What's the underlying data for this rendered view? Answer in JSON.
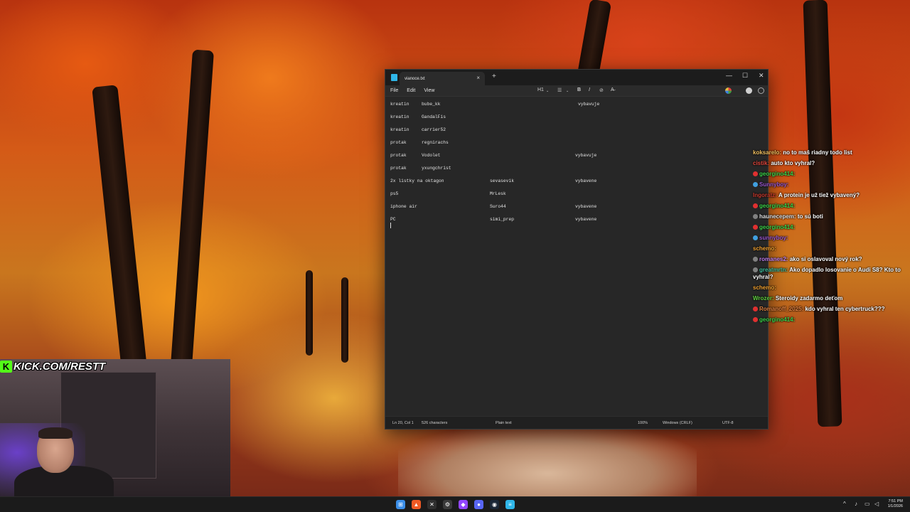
{
  "notepad": {
    "tab_title": "vianoce.txt",
    "tab_close": "×",
    "new_tab": "+",
    "window_controls": {
      "minimize": "—",
      "maximize": "☐",
      "close": "✕"
    },
    "menu": [
      "File",
      "Edit",
      "View"
    ],
    "format_toolbar": {
      "heading": "H1",
      "list": "☰",
      "bold": "B",
      "italic": "I",
      "link": "⊘",
      "clear": "A̶"
    },
    "lines": [
      {
        "c1": "kreatin",
        "c2": "bube_kk",
        "c3": "",
        "c4": "vybavuje"
      },
      {
        "c1": "kreatin",
        "c2": "GandalFis",
        "c3": "",
        "c4": ""
      },
      {
        "c1": "kreatin",
        "c2": "carrier52",
        "c3": "",
        "c4": ""
      },
      {
        "c1": "protak",
        "c2": "regnirachs",
        "c3": "",
        "c4": ""
      },
      {
        "c1": "protak",
        "c2": "Vodolet",
        "c3": "",
        "c4": "vybavuje"
      },
      {
        "c1": "protak",
        "c2": "yxungchrist",
        "c3": "",
        "c4": ""
      },
      {
        "c1": "2x listky na oktagon",
        "c2": "",
        "c3": "sevasevik",
        "c4": "vybavene"
      },
      {
        "c1": "ps5",
        "c2": "",
        "c3": "MrLesk",
        "c4": ""
      },
      {
        "c1": "iphone air",
        "c2": "",
        "c3": "Suro44",
        "c4": "vybavene"
      },
      {
        "c1": "PC",
        "c2": "",
        "c3": "simi_prep",
        "c4": "vybavene"
      }
    ],
    "status": {
      "position": "Ln 20, Col 1",
      "characters": "526 characters",
      "format": "Plain text",
      "zoom": "100%",
      "line_ending": "Windows (CRLF)",
      "encoding": "UTF-8"
    }
  },
  "chat": [
    {
      "user": "koksarelo:",
      "text": "no to maš riadny todo list",
      "color": "#f0c060",
      "badge": ""
    },
    {
      "user": "cistik:",
      "text": "auto kto vyhral?",
      "color": "#e0463c",
      "badge": ""
    },
    {
      "user": "georgino414:",
      "text": "",
      "color": "#3bd24a",
      "badge": "#e03030"
    },
    {
      "user": "Sunnyboy:",
      "text": "",
      "color": "#9b59d0",
      "badge": "#40a0e0"
    },
    {
      "user": "Ingoratz:",
      "text": "A protein je už tiež vybavený?",
      "color": "#c83a2e",
      "badge": ""
    },
    {
      "user": "georgino414:",
      "text": "",
      "color": "#3bd24a",
      "badge": "#e03030"
    },
    {
      "user": "haunecepem:",
      "text": "to sú boti",
      "color": "#e0e0e0",
      "badge": "#808080"
    },
    {
      "user": "georgino414:",
      "text": "",
      "color": "#3bd24a",
      "badge": "#e03030"
    },
    {
      "user": "sunnyboy:",
      "text": "",
      "color": "#9b59d0",
      "badge": "#40a0e0"
    },
    {
      "user": "schemo:",
      "text": "",
      "color": "#f0a030",
      "badge": ""
    },
    {
      "user": "romanes2:",
      "text": "ako si oslavoval nový rok?",
      "color": "#c080f0",
      "badge": "#808080"
    },
    {
      "user": "greatmrtn:",
      "text": "Ako dopadlo losovanie o Audi S8? Kto to vyhral?",
      "color": "#40c0a0",
      "badge": "#808080"
    },
    {
      "user": "schemo:",
      "text": "",
      "color": "#f0a030",
      "badge": ""
    },
    {
      "user": "Wrozer:",
      "text": "Steroidy zadarmo deťom",
      "color": "#60d040",
      "badge": ""
    },
    {
      "user": "Romanoff_2025:",
      "text": "kdo vyhral ten cybertruck???",
      "color": "#e08040",
      "badge": "#e03030"
    },
    {
      "user": "georgino414:",
      "text": "",
      "color": "#3bd24a",
      "badge": "#e03030"
    }
  ],
  "stream": {
    "kick_logo": "K",
    "kick_url": "KICK.COM/RESTT"
  },
  "taskbar": {
    "icons": [
      {
        "name": "start-icon",
        "glyph": "⊞",
        "color": "#3b8ee8"
      },
      {
        "name": "brave-icon",
        "glyph": "▲",
        "color": "#f05a24"
      },
      {
        "name": "terminal-icon",
        "glyph": "✕",
        "color": "#2f2f2f"
      },
      {
        "name": "settings-icon",
        "glyph": "⚙",
        "color": "#3a3a3a"
      },
      {
        "name": "twitch-icon",
        "glyph": "◆",
        "color": "#9146ff"
      },
      {
        "name": "discord-icon",
        "glyph": "●",
        "color": "#5865f2"
      },
      {
        "name": "steam-icon",
        "glyph": "◉",
        "color": "#1b2838"
      },
      {
        "name": "notepad-icon",
        "glyph": "≡",
        "color": "#2fb6e8"
      }
    ],
    "time": "7:51 PM",
    "date": "1/1/2026"
  }
}
